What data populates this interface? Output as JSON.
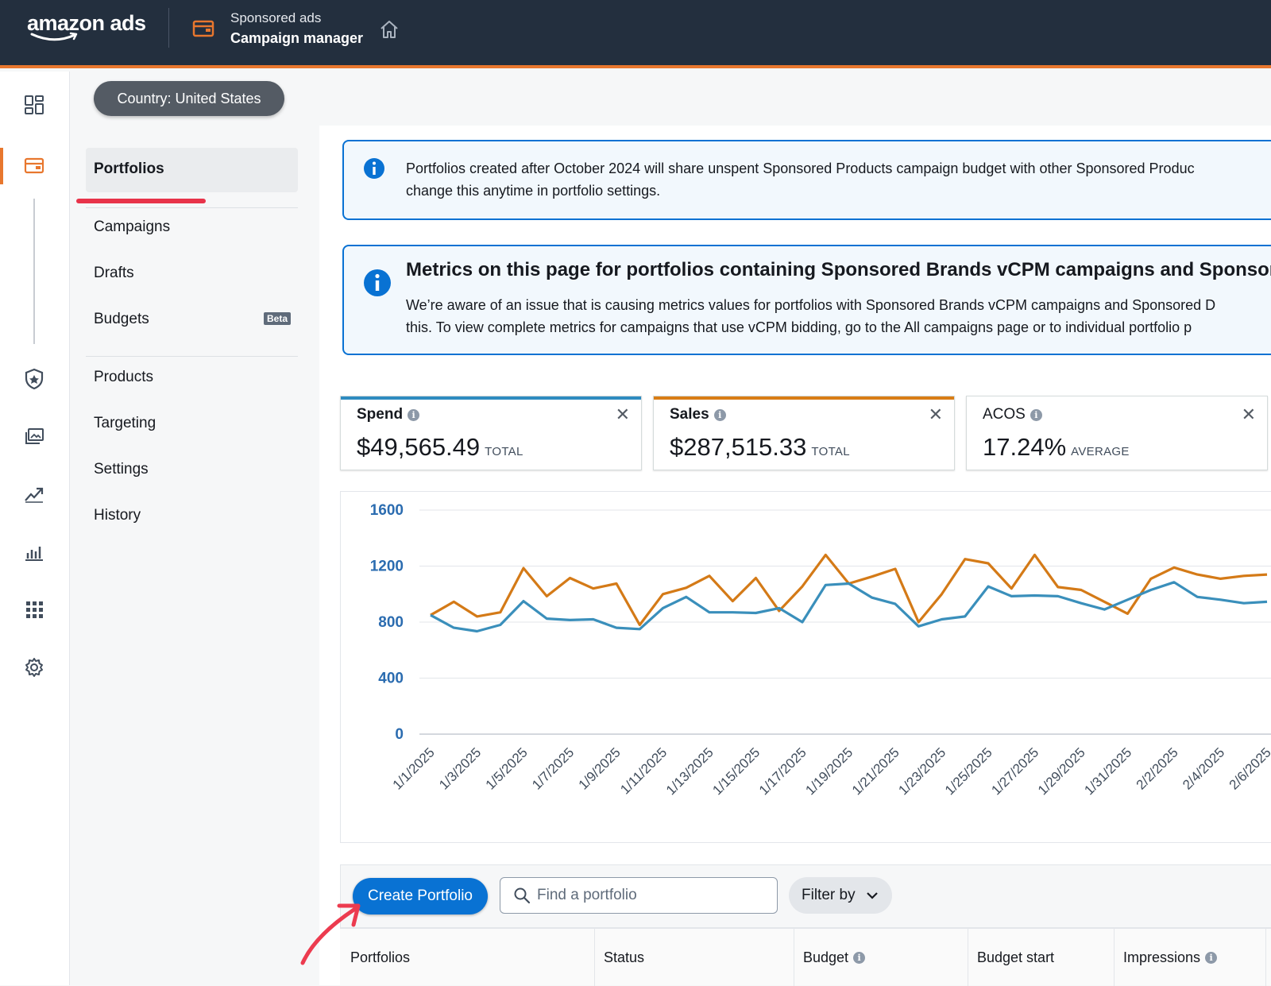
{
  "header": {
    "logo": "amazon ads",
    "section": "Sponsored ads",
    "title": "Campaign manager"
  },
  "country_pill": "Country: United States",
  "subnav": {
    "items": [
      {
        "label": "Portfolios",
        "active": true
      },
      {
        "label": "Campaigns"
      },
      {
        "label": "Drafts"
      },
      {
        "label": "Budgets",
        "badge": "Beta"
      },
      {
        "label": "Products"
      },
      {
        "label": "Targeting"
      },
      {
        "label": "Settings"
      },
      {
        "label": "History"
      }
    ]
  },
  "rail_icons": [
    "dashboard-icon",
    "wallet-icon",
    "shield-icon",
    "media-icon",
    "trend-icon",
    "bar-chart-icon",
    "apps-grid-icon",
    "gear-icon"
  ],
  "alerts": [
    {
      "line1": "Portfolios created after October 2024 will share unspent Sponsored Products campaign budget with other Sponsored Produc",
      "line2": "change this anytime in portfolio settings."
    },
    {
      "title": "Metrics on this page for portfolios containing Sponsored Brands vCPM campaigns and Sponsor",
      "line1": "We’re aware of an issue that is causing metrics values for portfolios with Sponsored Brands vCPM campaigns and Sponsored D",
      "line2": "this. To view complete metrics for campaigns that use vCPM bidding, go to the All campaigns page or to individual portfolio p"
    }
  ],
  "metrics": [
    {
      "label": "Spend",
      "value": "$49,565.49",
      "unit": "TOTAL",
      "color": "#2e8bc0"
    },
    {
      "label": "Sales",
      "value": "$287,515.33",
      "unit": "TOTAL",
      "color": "#d97d16"
    },
    {
      "label": "ACOS",
      "value": "17.24%",
      "unit": "AVERAGE",
      "color": ""
    }
  ],
  "colors": {
    "spend": "#3a8fbb",
    "sales": "#d47a17",
    "accent": "#e8772e",
    "primary": "#0972d3"
  },
  "chart_data": {
    "type": "line",
    "x": [
      "1/1/2025",
      "1/2/2025",
      "1/3/2025",
      "1/4/2025",
      "1/5/2025",
      "1/6/2025",
      "1/7/2025",
      "1/8/2025",
      "1/9/2025",
      "1/10/2025",
      "1/11/2025",
      "1/12/2025",
      "1/13/2025",
      "1/14/2025",
      "1/15/2025",
      "1/16/2025",
      "1/17/2025",
      "1/18/2025",
      "1/19/2025",
      "1/20/2025",
      "1/21/2025",
      "1/22/2025",
      "1/23/2025",
      "1/24/2025",
      "1/25/2025",
      "1/26/2025",
      "1/27/2025",
      "1/28/2025",
      "1/29/2025",
      "1/30/2025",
      "1/31/2025",
      "2/1/2025",
      "2/2/2025",
      "2/3/2025",
      "2/4/2025",
      "2/5/2025",
      "2/6/2025"
    ],
    "tick_labels": [
      "1/1/2025",
      "1/3/2025",
      "1/5/2025",
      "1/7/2025",
      "1/9/2025",
      "1/11/2025",
      "1/13/2025",
      "1/15/2025",
      "1/17/2025",
      "1/19/2025",
      "1/21/2025",
      "1/23/2025",
      "1/25/2025",
      "1/27/2025",
      "1/29/2025",
      "1/31/2025",
      "2/2/2025",
      "2/4/2025",
      "2/6/2025"
    ],
    "yticks": [
      0,
      400,
      800,
      1200,
      1600
    ],
    "ylim": [
      0,
      1600
    ],
    "grid": true,
    "series": [
      {
        "name": "Sales",
        "values": [
          850,
          945,
          840,
          870,
          1185,
          985,
          1115,
          1040,
          1075,
          780,
          1000,
          1045,
          1130,
          950,
          1115,
          880,
          1055,
          1280,
          1075,
          1125,
          1180,
          800,
          1000,
          1250,
          1220,
          1040,
          1280,
          1050,
          1030,
          945,
          860,
          1110,
          1190,
          1140,
          1110,
          1130,
          1140
        ]
      },
      {
        "name": "Spend",
        "values": [
          850,
          760,
          735,
          780,
          950,
          825,
          815,
          820,
          760,
          750,
          900,
          980,
          870,
          870,
          865,
          900,
          800,
          1065,
          1075,
          975,
          930,
          770,
          820,
          840,
          1055,
          985,
          990,
          985,
          935,
          890,
          960,
          1030,
          1085,
          980,
          960,
          935,
          945
        ]
      }
    ]
  },
  "toolbar": {
    "create_label": "Create Portfolio",
    "search_placeholder": "Find a portfolio",
    "filter_label": "Filter by"
  },
  "table": {
    "columns": [
      "Portfolios",
      "Status",
      "Budget",
      "Budget start",
      "Impressions"
    ]
  }
}
